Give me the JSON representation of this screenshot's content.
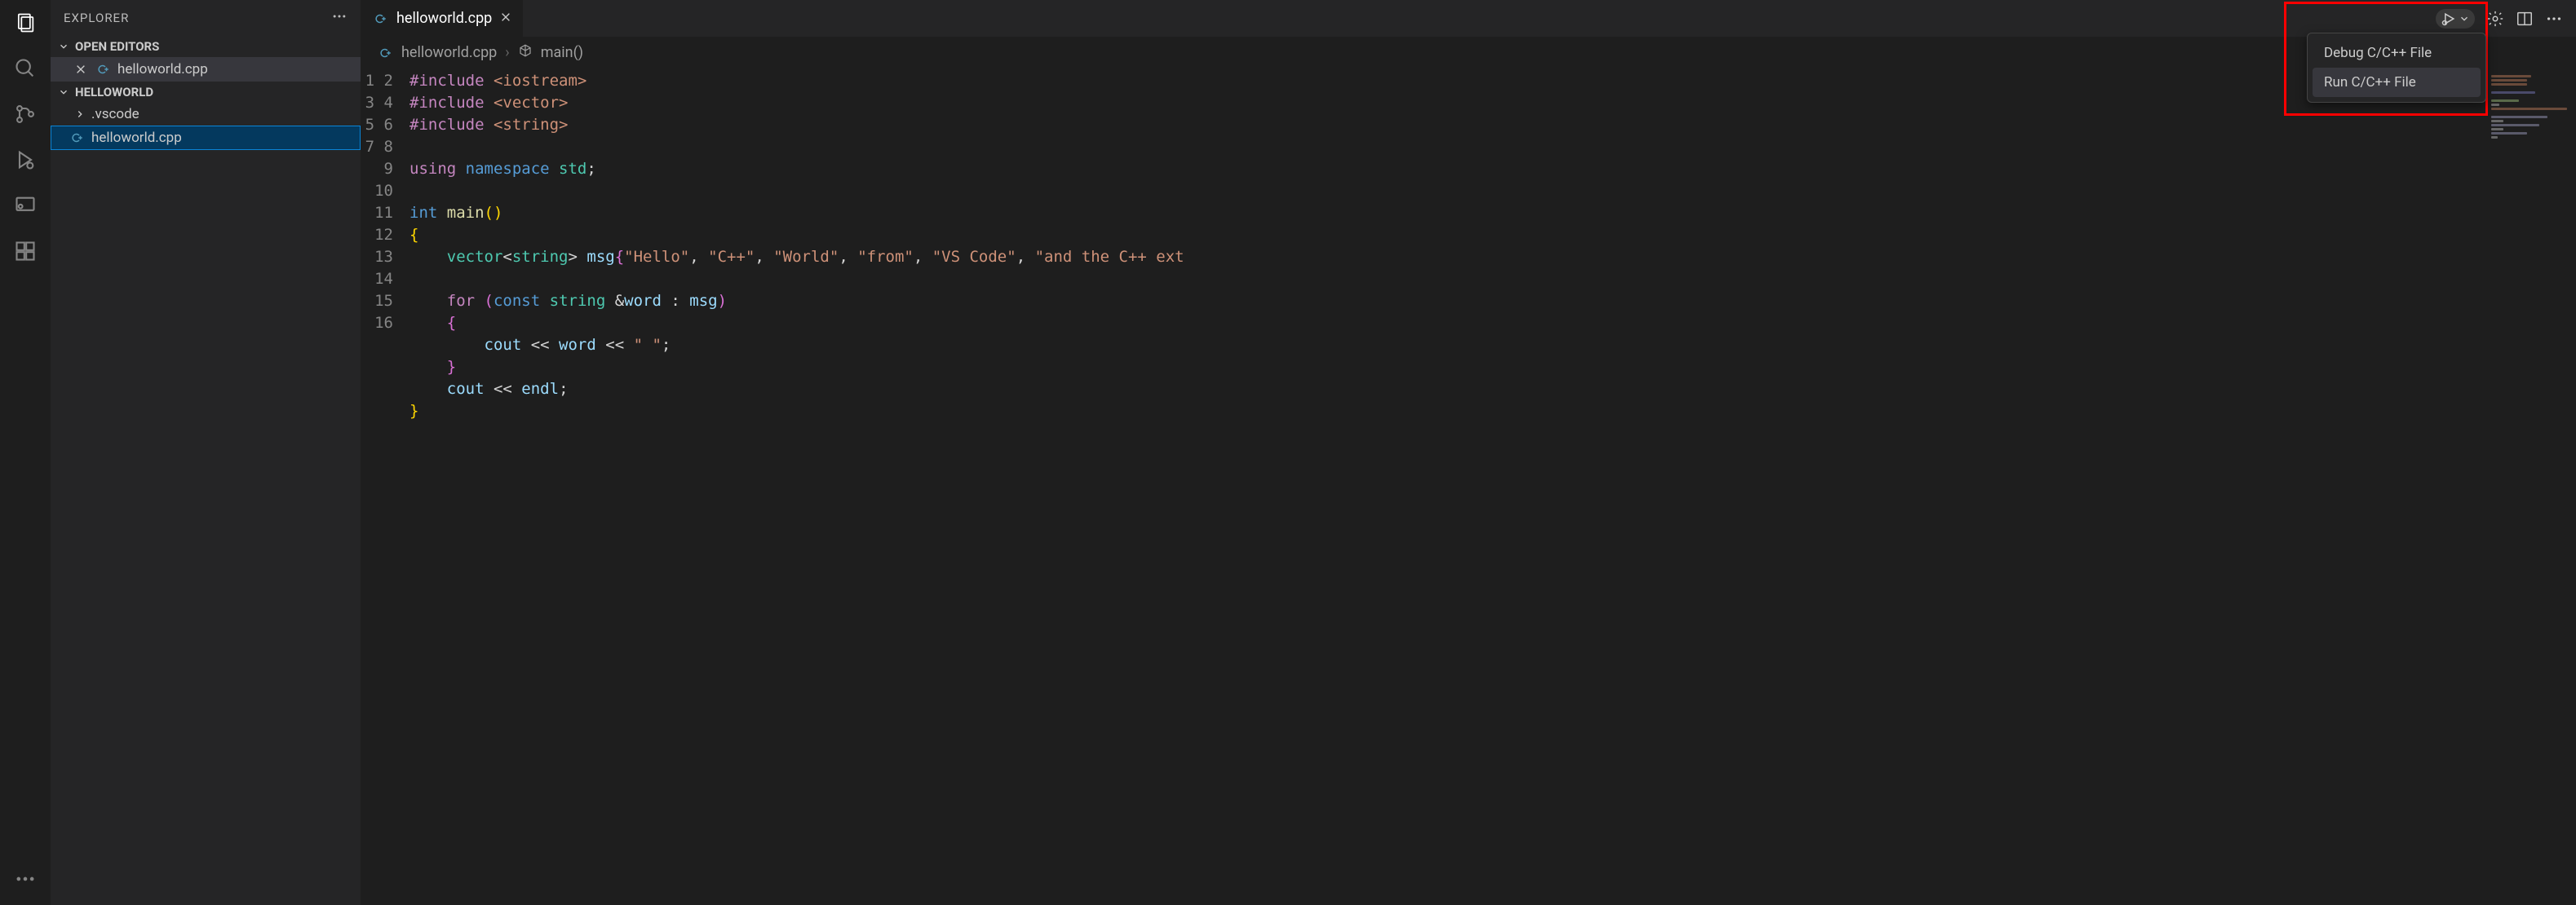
{
  "sidebar": {
    "title": "EXPLORER",
    "sections": {
      "open_editors_label": "OPEN EDITORS",
      "workspace_label": "HELLOWORLD"
    },
    "open_editor_file": "helloworld.cpp",
    "folders": [
      ".vscode"
    ],
    "files": [
      "helloworld.cpp"
    ]
  },
  "tab": {
    "filename": "helloworld.cpp"
  },
  "breadcrumb": {
    "file": "helloworld.cpp",
    "symbol": "main()"
  },
  "run_menu": {
    "debug_label": "Debug C/C++ File",
    "run_label": "Run C/C++ File"
  },
  "code": {
    "lines": [
      {
        "n": 1,
        "tokens": [
          [
            "#include ",
            "keyword"
          ],
          [
            "<iostream>",
            "string"
          ]
        ]
      },
      {
        "n": 2,
        "tokens": [
          [
            "#include ",
            "keyword"
          ],
          [
            "<vector>",
            "string"
          ]
        ]
      },
      {
        "n": 3,
        "tokens": [
          [
            "#include ",
            "keyword"
          ],
          [
            "<string>",
            "string"
          ]
        ]
      },
      {
        "n": 4,
        "tokens": [
          [
            "",
            ""
          ]
        ]
      },
      {
        "n": 5,
        "tokens": [
          [
            "using ",
            "keyword"
          ],
          [
            "namespace ",
            "blue"
          ],
          [
            "std",
            "ns"
          ],
          [
            ";",
            "punct"
          ]
        ]
      },
      {
        "n": 6,
        "tokens": [
          [
            "",
            ""
          ]
        ]
      },
      {
        "n": 7,
        "tokens": [
          [
            "int ",
            "blue"
          ],
          [
            "main",
            "func"
          ],
          [
            "()",
            "brace3"
          ]
        ]
      },
      {
        "n": 8,
        "tokens": [
          [
            "{",
            "brace3"
          ]
        ]
      },
      {
        "n": 9,
        "tokens": [
          [
            "    ",
            ""
          ],
          [
            "vector",
            "type"
          ],
          [
            "<",
            "op"
          ],
          [
            "string",
            "type"
          ],
          [
            "> ",
            "op"
          ],
          [
            "msg",
            "var"
          ],
          [
            "{",
            "brace"
          ],
          [
            "\"Hello\"",
            "string"
          ],
          [
            ", ",
            "punct"
          ],
          [
            "\"C++\"",
            "string"
          ],
          [
            ", ",
            "punct"
          ],
          [
            "\"World\"",
            "string"
          ],
          [
            ", ",
            "punct"
          ],
          [
            "\"from\"",
            "string"
          ],
          [
            ", ",
            "punct"
          ],
          [
            "\"VS Code\"",
            "string"
          ],
          [
            ", ",
            "punct"
          ],
          [
            "\"and the C++ ext",
            "string"
          ]
        ]
      },
      {
        "n": 10,
        "tokens": [
          [
            "",
            ""
          ]
        ]
      },
      {
        "n": 11,
        "tokens": [
          [
            "    ",
            ""
          ],
          [
            "for ",
            "keyword"
          ],
          [
            "(",
            "brace"
          ],
          [
            "const ",
            "blue"
          ],
          [
            "string ",
            "type"
          ],
          [
            "&",
            "op"
          ],
          [
            "word ",
            "var"
          ],
          [
            ": ",
            "punct"
          ],
          [
            "msg",
            "var"
          ],
          [
            ")",
            "brace"
          ]
        ]
      },
      {
        "n": 12,
        "tokens": [
          [
            "    ",
            ""
          ],
          [
            "{",
            "brace"
          ]
        ]
      },
      {
        "n": 13,
        "tokens": [
          [
            "        ",
            ""
          ],
          [
            "cout ",
            "var"
          ],
          [
            "<< ",
            "op"
          ],
          [
            "word ",
            "var"
          ],
          [
            "<< ",
            "op"
          ],
          [
            "\" \"",
            "string"
          ],
          [
            ";",
            "punct"
          ]
        ]
      },
      {
        "n": 14,
        "tokens": [
          [
            "    ",
            ""
          ],
          [
            "}",
            "brace"
          ]
        ]
      },
      {
        "n": 15,
        "tokens": [
          [
            "    ",
            ""
          ],
          [
            "cout ",
            "var"
          ],
          [
            "<< ",
            "op"
          ],
          [
            "endl",
            "var"
          ],
          [
            ";",
            "punct"
          ]
        ]
      },
      {
        "n": 16,
        "tokens": [
          [
            "}",
            "brace3"
          ]
        ]
      }
    ]
  }
}
